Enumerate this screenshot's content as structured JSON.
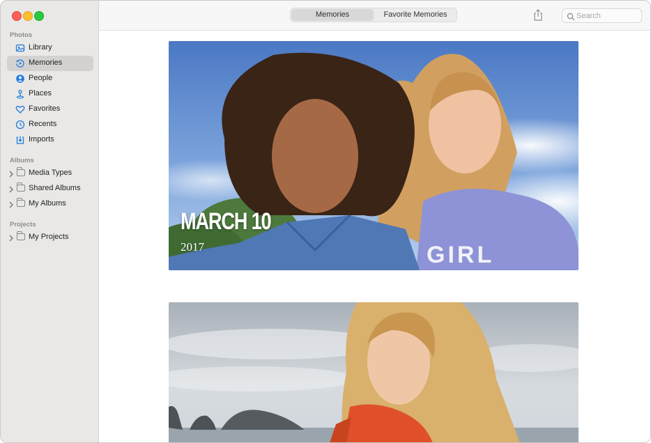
{
  "window": {
    "traffic_lights": {
      "close": "#fe5f57",
      "minimize": "#febc2e",
      "zoom": "#28c840"
    }
  },
  "sidebar": {
    "sections": [
      {
        "heading": "Photos",
        "items": [
          {
            "label": "Library",
            "icon": "library-icon"
          },
          {
            "label": "Memories",
            "icon": "memories-icon",
            "selected": true
          },
          {
            "label": "People",
            "icon": "people-icon"
          },
          {
            "label": "Places",
            "icon": "places-icon"
          },
          {
            "label": "Favorites",
            "icon": "heart-icon"
          },
          {
            "label": "Recents",
            "icon": "clock-icon"
          },
          {
            "label": "Imports",
            "icon": "imports-icon"
          }
        ]
      },
      {
        "heading": "Albums",
        "items": [
          {
            "label": "Media Types",
            "icon": "folder-icon"
          },
          {
            "label": "Shared Albums",
            "icon": "shared-folder-icon"
          },
          {
            "label": "My Albums",
            "icon": "folder-icon"
          }
        ]
      },
      {
        "heading": "Projects",
        "items": [
          {
            "label": "My Projects",
            "icon": "folder-icon"
          }
        ]
      }
    ]
  },
  "toolbar": {
    "tabs": [
      {
        "label": "Memories",
        "active": true
      },
      {
        "label": "Favorite Memories",
        "active": false
      }
    ],
    "share_icon": "share-icon",
    "search": {
      "placeholder": "Search",
      "value": ""
    }
  },
  "memories": [
    {
      "title": "MARCH 10",
      "year": "2017"
    },
    {
      "title": "",
      "year": ""
    }
  ],
  "colors": {
    "accent": "#1f7ae0",
    "sidebar_bg": "#e9e8e7",
    "selection": "#d3d2d1"
  }
}
